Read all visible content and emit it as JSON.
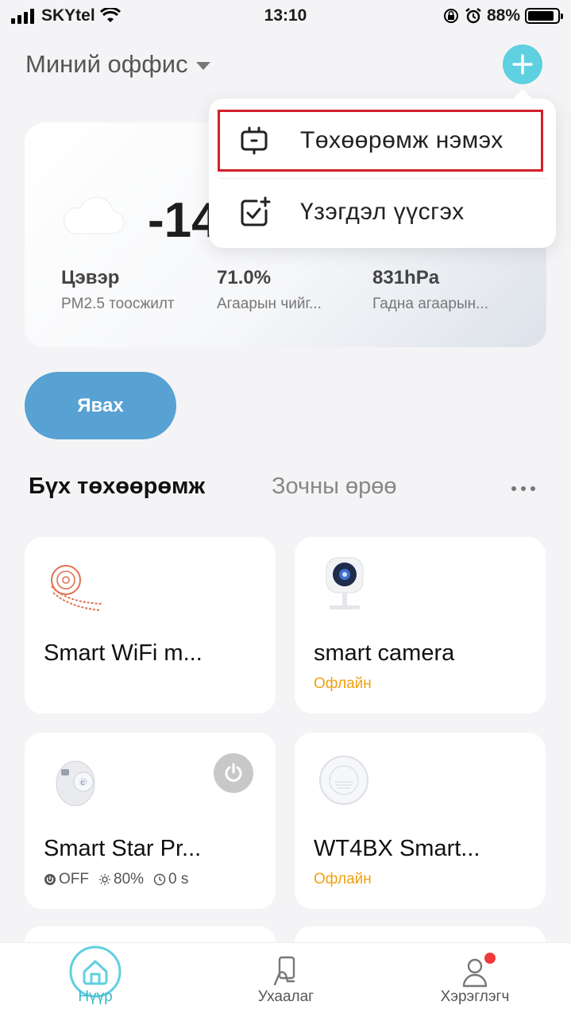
{
  "status_bar": {
    "carrier": "SKYtel",
    "time": "13:10",
    "battery": "88%",
    "battery_level": 0.88
  },
  "header": {
    "home_name": "Миний оффис",
    "add_icon": "plus-icon"
  },
  "dropdown": {
    "items": [
      {
        "label": "Төхөөрөмж нэмэх",
        "icon": "device-add-icon",
        "highlighted": true
      },
      {
        "label": "Үзэгдэл үүсгэх",
        "icon": "scene-create-icon"
      }
    ]
  },
  "weather": {
    "icon": "cloud-icon",
    "temperature": "-14",
    "stats": [
      {
        "value": "Цэвэр",
        "label": "PM2.5 тоосжилт"
      },
      {
        "value": "71.0%",
        "label": "Агаарын чийг..."
      },
      {
        "value": "831hPa",
        "label": "Гадна агаарын..."
      }
    ]
  },
  "go_button": {
    "label": "Явах"
  },
  "tabs": {
    "items": [
      "Бүх төхөөрөмж",
      "Зочны өрөө"
    ],
    "active": "Бүх төхөөрөмж",
    "more_icon": "more-dots-icon"
  },
  "devices": [
    {
      "name": "Smart WiFi m...",
      "status": "",
      "icon": "led-strip-icon"
    },
    {
      "name": "smart camera",
      "status": "Офлайн",
      "icon": "camera-icon"
    },
    {
      "name": "Smart Star Pr...",
      "icon": "star-projector-icon",
      "meta": {
        "power": "OFF",
        "brightness": "80%",
        "timer": "0 s"
      },
      "power_icon": "power-icon"
    },
    {
      "name": "WT4BX Smart...",
      "status": "Офлайн",
      "icon": "smoke-detector-icon"
    }
  ],
  "bottom_nav": {
    "items": [
      {
        "label": "Нүүр",
        "icon": "home-icon",
        "active": true
      },
      {
        "label": "Ухаалаг",
        "icon": "smart-icon"
      },
      {
        "label": "Хэрэглэгч",
        "icon": "user-icon",
        "badge": true
      }
    ]
  },
  "colors": {
    "accent": "#5fd0df",
    "go_button": "#58a1d3",
    "offline": "#f0a010",
    "highlight_border": "#d3202a",
    "nav_active": "#3cb8c8"
  }
}
